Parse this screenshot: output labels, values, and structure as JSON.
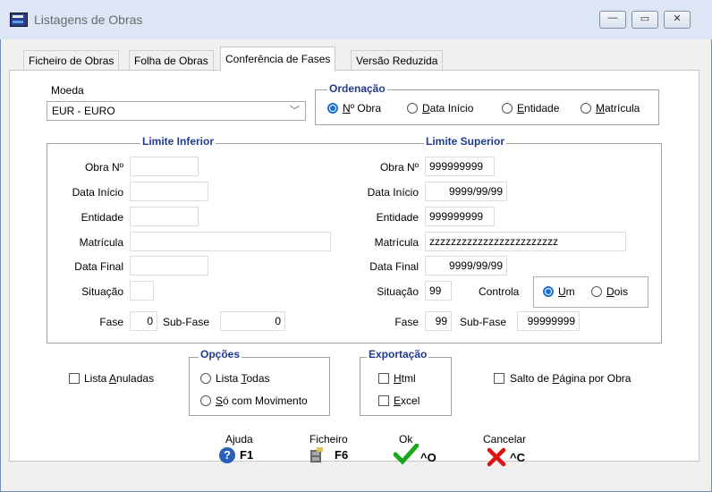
{
  "window": {
    "title": "Listagens de Obras",
    "minimize": "—",
    "maximize": "▭",
    "close": "✕"
  },
  "tabs": [
    "Ficheiro de Obras",
    "Folha de Obras",
    "Conferência de Fases",
    "Versão Reduzida"
  ],
  "active_tab": "Conferência de Fases",
  "moeda": {
    "label": "Moeda",
    "value": "EUR - EURO"
  },
  "ordenacao": {
    "title": "Ordenação",
    "options": [
      {
        "pre": "",
        "u": "N",
        "post": "º Obra",
        "selected": true
      },
      {
        "pre": "",
        "u": "D",
        "post": "ata Início",
        "selected": false
      },
      {
        "pre": "",
        "u": "E",
        "post": "ntidade",
        "selected": false
      },
      {
        "pre": "",
        "u": "M",
        "post": "atrícula",
        "selected": false
      }
    ]
  },
  "limite_inferior": {
    "title": "Limite Inferior",
    "labels": {
      "obra": "Obra Nº",
      "data_inicio": "Data Início",
      "entidade": "Entidade",
      "matricula": "Matrícula",
      "data_final": "Data Final",
      "situacao": "Situação",
      "fase": "Fase",
      "sub_fase": "Sub-Fase"
    },
    "values": {
      "obra": "",
      "data_inicio": "",
      "entidade": "",
      "matricula": "",
      "data_final": "",
      "situacao": "",
      "fase": "0",
      "sub_fase": "0"
    }
  },
  "limite_superior": {
    "title": "Limite Superior",
    "labels": {
      "obra": "Obra Nº",
      "data_inicio": "Data Início",
      "entidade": "Entidade",
      "matricula": "Matrícula",
      "data_final": "Data Final",
      "situacao": "Situação",
      "controla": "Controla",
      "fase": "Fase",
      "sub_fase": "Sub-Fase"
    },
    "values": {
      "obra": "999999999",
      "data_inicio": "9999/99/99",
      "entidade": "999999999",
      "matricula": "zzzzzzzzzzzzzzzzzzzzzzzz",
      "data_final": "9999/99/99",
      "situacao": "99",
      "fase": "99",
      "sub_fase": "99999999"
    },
    "controla_options": [
      {
        "u": "U",
        "post": "m",
        "selected": true
      },
      {
        "u": "D",
        "post": "ois",
        "selected": false
      }
    ]
  },
  "lista_anuladas": {
    "pre": "Lista ",
    "u": "A",
    "post": "nuladas",
    "checked": false
  },
  "opcoes": {
    "title": "Opções",
    "options": [
      {
        "pre": "Lista ",
        "u": "T",
        "post": "odas",
        "selected": false
      },
      {
        "pre": "",
        "u": "S",
        "post": "ó com Movimento",
        "selected": false
      }
    ]
  },
  "exportacao": {
    "title": "Exportação",
    "options": [
      {
        "u": "H",
        "post": "tml",
        "checked": false
      },
      {
        "u": "E",
        "post": "xcel",
        "checked": false
      }
    ]
  },
  "salto": {
    "pre": "Salto de ",
    "u": "P",
    "post": "ágina por Obra",
    "checked": false
  },
  "buttons": [
    {
      "caption": "Ajuda",
      "key": "F1"
    },
    {
      "caption": "Ficheiro",
      "key": "F6"
    },
    {
      "caption": "Ok",
      "key": "^O"
    },
    {
      "caption": "Cancelar",
      "key": "^C"
    }
  ],
  "colors": {
    "group_title": "#1f3b8f",
    "radio_selected": "#1a6fd1",
    "ok": "#1aa81a",
    "cancel": "#e01010",
    "help": "#2a5fb8"
  }
}
